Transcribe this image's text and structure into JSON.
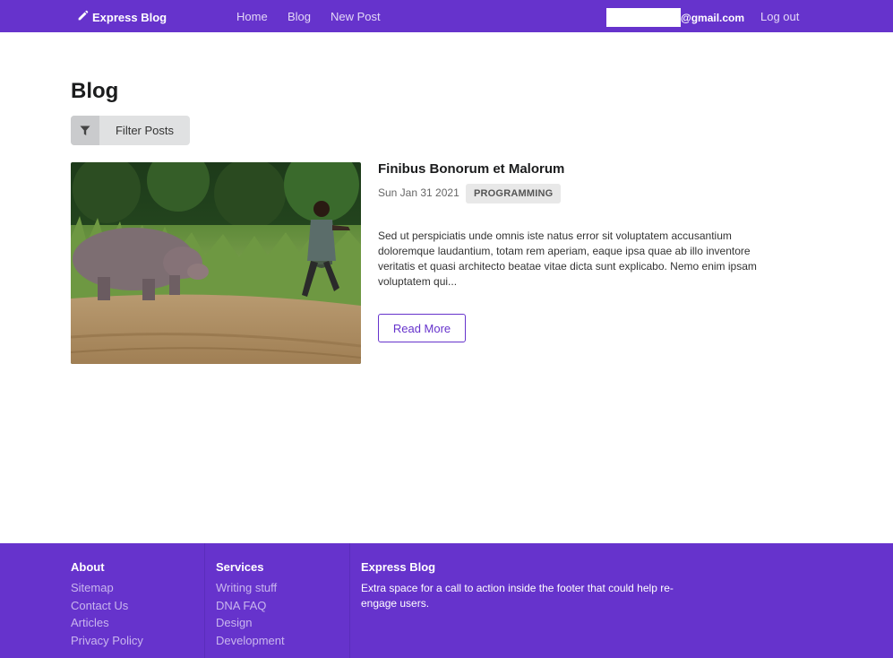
{
  "navbar": {
    "brand": "Express Blog",
    "links": {
      "home": "Home",
      "blog": "Blog",
      "new_post": "New Post"
    },
    "email_domain": "@gmail.com",
    "logout": "Log out"
  },
  "page": {
    "title": "Blog"
  },
  "filter": {
    "label": "Filter Posts"
  },
  "post": {
    "title": "Finibus Bonorum et Malorum",
    "date": "Sun Jan 31 2021",
    "tag": "PROGRAMMING",
    "excerpt": "Sed ut perspiciatis unde omnis iste natus error sit voluptatem accusantium doloremque laudantium, totam rem aperiam, eaque ipsa quae ab illo inventore veritatis et quasi architecto beatae vitae dicta sunt explicabo. Nemo enim ipsam voluptatem qui...",
    "read_more": "Read More"
  },
  "footer": {
    "about": {
      "title": "About",
      "items": [
        "Sitemap",
        "Contact Us",
        "Articles",
        "Privacy Policy"
      ]
    },
    "services": {
      "title": "Services",
      "items": [
        "Writing stuff",
        "DNA FAQ",
        "Design",
        "Development"
      ]
    },
    "brand": {
      "title": "Express Blog",
      "text": "Extra space for a call to action inside the footer that could help re-engage users."
    }
  },
  "colors": {
    "primary": "#6633cc",
    "footer_link": "#c9b6ee",
    "button_bg": "#e0e1e2"
  },
  "icons": {
    "brand": "pencil-icon",
    "filter": "filter-icon"
  }
}
